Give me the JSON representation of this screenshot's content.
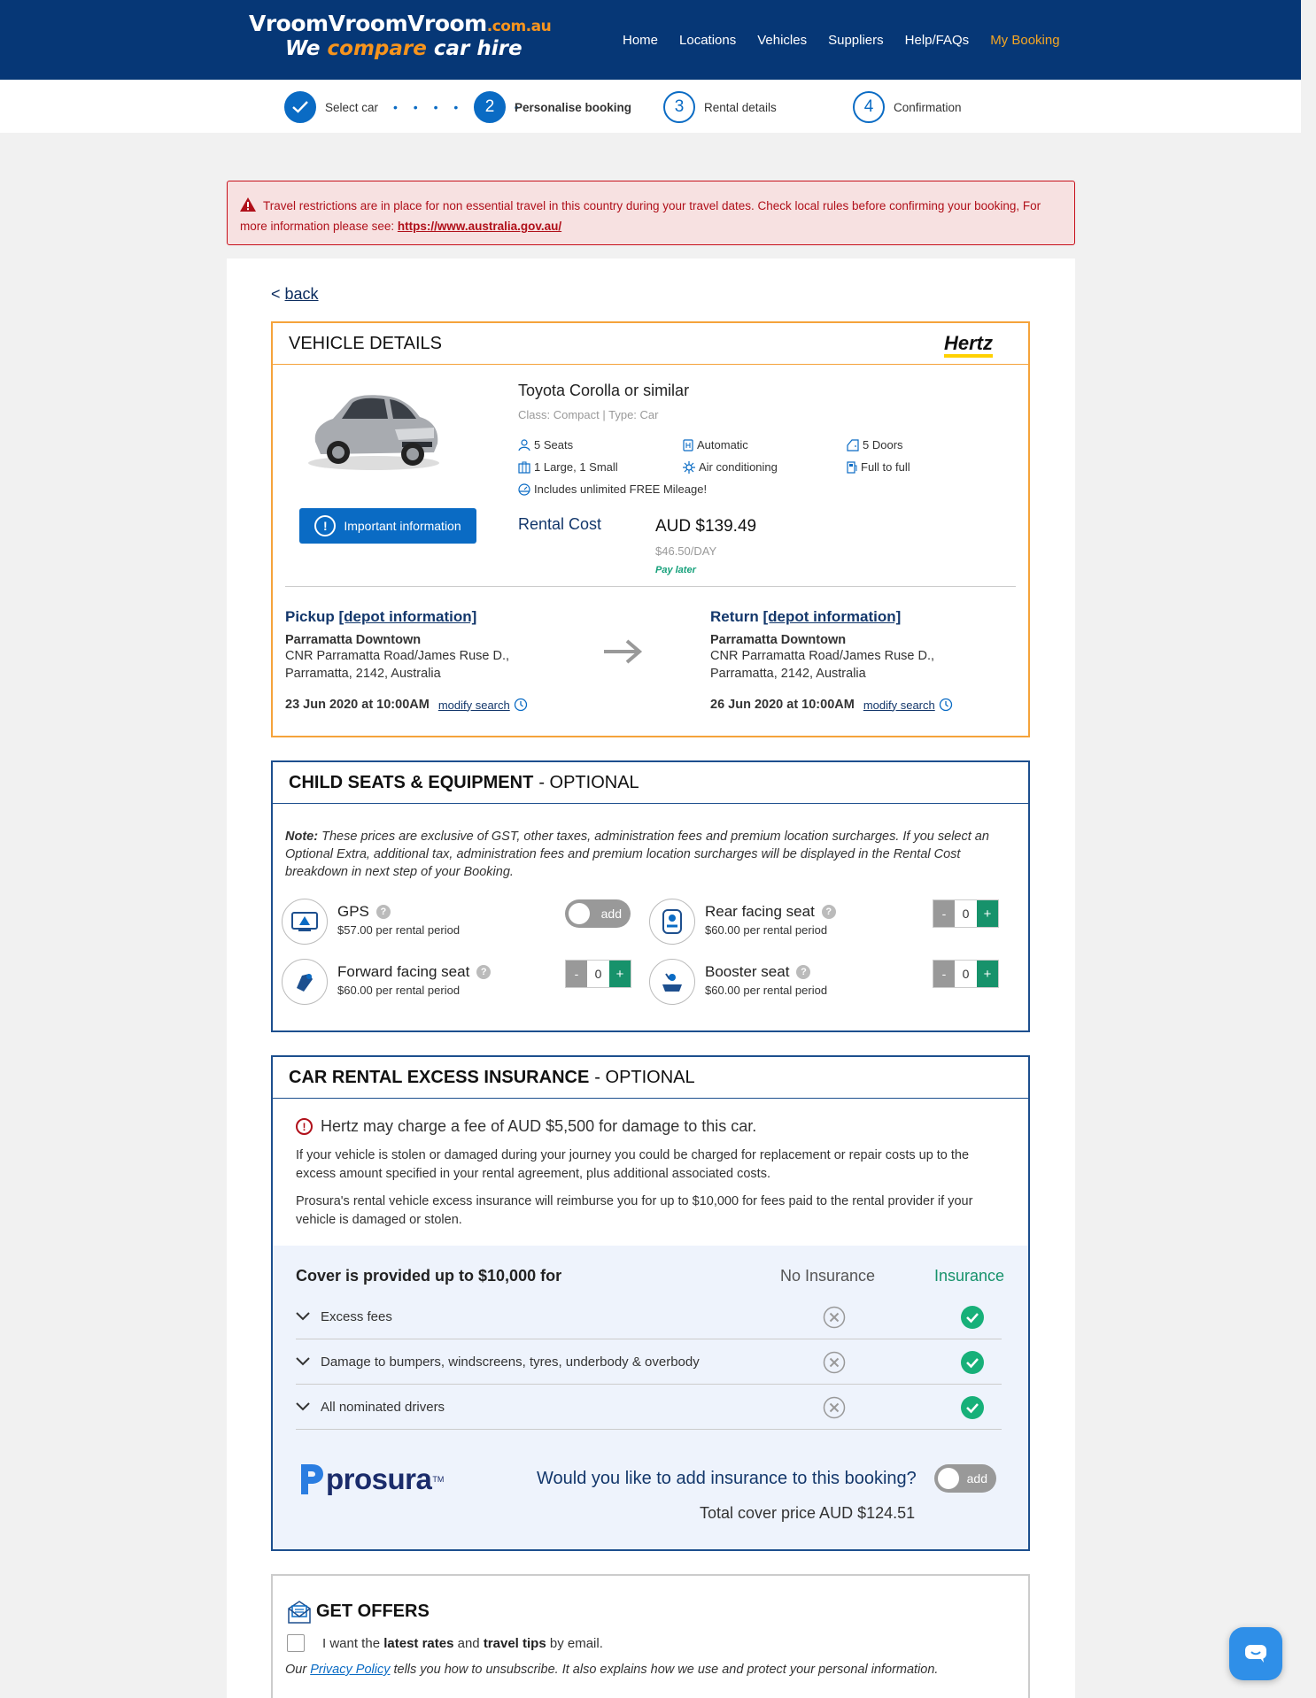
{
  "header": {
    "logo": {
      "line1": "VroomVroomVroom",
      "domain": ".com.au",
      "line2_a": "We",
      "line2_b": "compare",
      "line2_c": "car hire"
    },
    "nav": [
      "Home",
      "Locations",
      "Vehicles",
      "Suppliers",
      "Help/FAQs",
      "My Booking"
    ],
    "active_nav": "My Booking"
  },
  "steps": [
    {
      "num": "",
      "label": "Select car",
      "state": "done"
    },
    {
      "num": "2",
      "label": "Personalise booking",
      "state": "current"
    },
    {
      "num": "3",
      "label": "Rental details",
      "state": "todo"
    },
    {
      "num": "4",
      "label": "Confirmation",
      "state": "todo"
    }
  ],
  "alert": {
    "text": "Travel restrictions are in place for non essential travel in this country during your travel dates. Check local rules before confirming your booking, For more information please see: ",
    "link": "https://www.australia.gov.au/"
  },
  "back": {
    "prefix": "< ",
    "label": "back"
  },
  "vehicle": {
    "section_title": "VEHICLE DETAILS",
    "supplier": "Hertz",
    "important_btn": "Important information",
    "name": "Toyota Corolla or similar",
    "class": "Class: Compact | Type: Car",
    "features": {
      "seats": "5 Seats",
      "transmission": "Automatic",
      "doors": "5 Doors",
      "luggage": "1 Large, 1 Small",
      "aircon": "Air conditioning",
      "fuel": "Full to full",
      "mileage": "Includes unlimited FREE Mileage!"
    },
    "rental_cost_label": "Rental Cost",
    "price": "AUD $139.49",
    "per_day": "$46.50/DAY",
    "pay": "Pay later",
    "pickup": {
      "title": "Pickup",
      "link": "[depot information]",
      "name": "Parramatta Downtown",
      "addr1": "CNR Parramatta Road/James Ruse D.,",
      "addr2": "Parramatta, 2142, Australia",
      "datetime": "23 Jun 2020 at 10:00AM",
      "modify": "modify search"
    },
    "return": {
      "title": "Return",
      "link": "[depot information]",
      "name": "Parramatta Downtown",
      "addr1": "CNR Parramatta Road/James Ruse D.,",
      "addr2": "Parramatta, 2142, Australia",
      "datetime": "26 Jun 2020 at 10:00AM",
      "modify": "modify search"
    }
  },
  "equipment": {
    "title": "CHILD SEATS & EQUIPMENT",
    "optional": "- OPTIONAL",
    "note_label": "Note:",
    "note": " These prices are exclusive of GST, other taxes, administration fees and premium location surcharges. If you select an Optional Extra, additional tax, administration fees and premium location surcharges will be displayed in the Rental Cost breakdown in next step of your Booking.",
    "items": [
      {
        "name": "GPS",
        "price": "$57.00 per rental period",
        "control": "toggle",
        "toggle_label": "add"
      },
      {
        "name": "Rear facing seat",
        "price": "$60.00 per rental period",
        "control": "stepper",
        "qty": "0"
      },
      {
        "name": "Forward facing seat",
        "price": "$60.00 per rental period",
        "control": "stepper",
        "qty": "0"
      },
      {
        "name": "Booster seat",
        "price": "$60.00 per rental period",
        "control": "stepper",
        "qty": "0"
      }
    ],
    "minus": "-",
    "plus": "+",
    "help": "?"
  },
  "insurance": {
    "title": "CAR RENTAL EXCESS INSURANCE",
    "optional": "- OPTIONAL",
    "fee_warning": "Hertz may charge a fee of AUD $5,500 for damage to this car.",
    "para1": "If your vehicle is stolen or damaged during your journey you could be charged for replacement or repair costs up to the excess amount specified in your rental agreement, plus additional associated costs.",
    "para2": "Prosura's rental vehicle excess insurance will reimburse you for up to $10,000 for fees paid to the rental provider if your vehicle is damaged or stolen.",
    "cover_heading": "Cover is provided up to $10,000 for",
    "col_no": "No Insurance",
    "col_yes": "Insurance",
    "rows": [
      "Excess fees",
      "Damage to bumpers, windscreens, tyres, underbody & overbody",
      "All nominated drivers"
    ],
    "brand": "prosura",
    "brand_tm": "TM",
    "question": "Would you like to add insurance to this booking?",
    "toggle_label": "add",
    "total": "Total cover price AUD $124.51"
  },
  "offers": {
    "title": "GET OFFERS",
    "check_a": "I want the ",
    "check_b": "latest rates",
    "check_c": " and ",
    "check_d": "travel tips",
    "check_e": " by email.",
    "pp_a": "Our ",
    "pp_link": "Privacy Policy",
    "pp_b": " tells you how to unsubscribe. It also explains how we use and protect your personal information."
  },
  "colors": {
    "navy": "#063776",
    "accent": "#f7941d",
    "blue": "#0a6bc4",
    "green": "#17926b",
    "alert": "#b0101a"
  }
}
